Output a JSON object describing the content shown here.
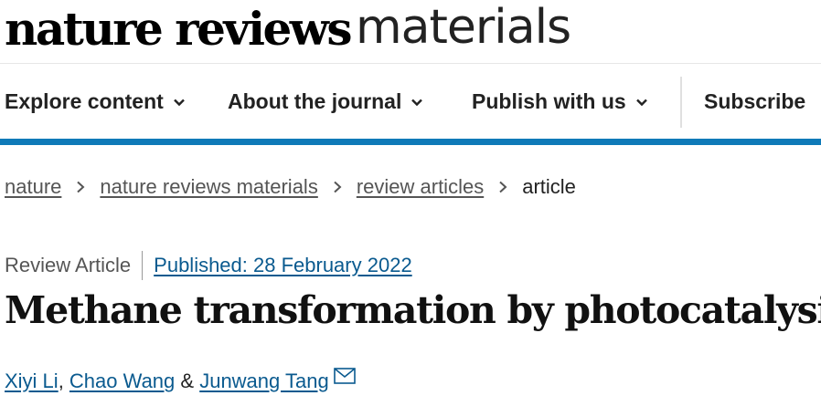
{
  "masthead": {
    "logo_bold": "nature reviews",
    "logo_light": "materials"
  },
  "nav": {
    "items": [
      {
        "label": "Explore content",
        "icon": "chevron-down-icon"
      },
      {
        "label": "About the journal",
        "icon": "chevron-down-icon"
      },
      {
        "label": "Publish with us",
        "icon": "chevron-down-icon"
      }
    ],
    "subscribe": "Subscribe",
    "accent_color": "#0f7ab8"
  },
  "breadcrumb": {
    "items": [
      "nature",
      "nature reviews materials",
      "review articles"
    ],
    "current": "article"
  },
  "article": {
    "type": "Review Article",
    "published": "Published: 28 February 2022",
    "title": "Methane transformation by photocatalysis",
    "authors": [
      "Xiyi Li",
      "Chao Wang",
      "Junwang Tang"
    ],
    "author_separators": [
      ", ",
      " & "
    ],
    "corresponding_icon": "envelope-icon"
  }
}
